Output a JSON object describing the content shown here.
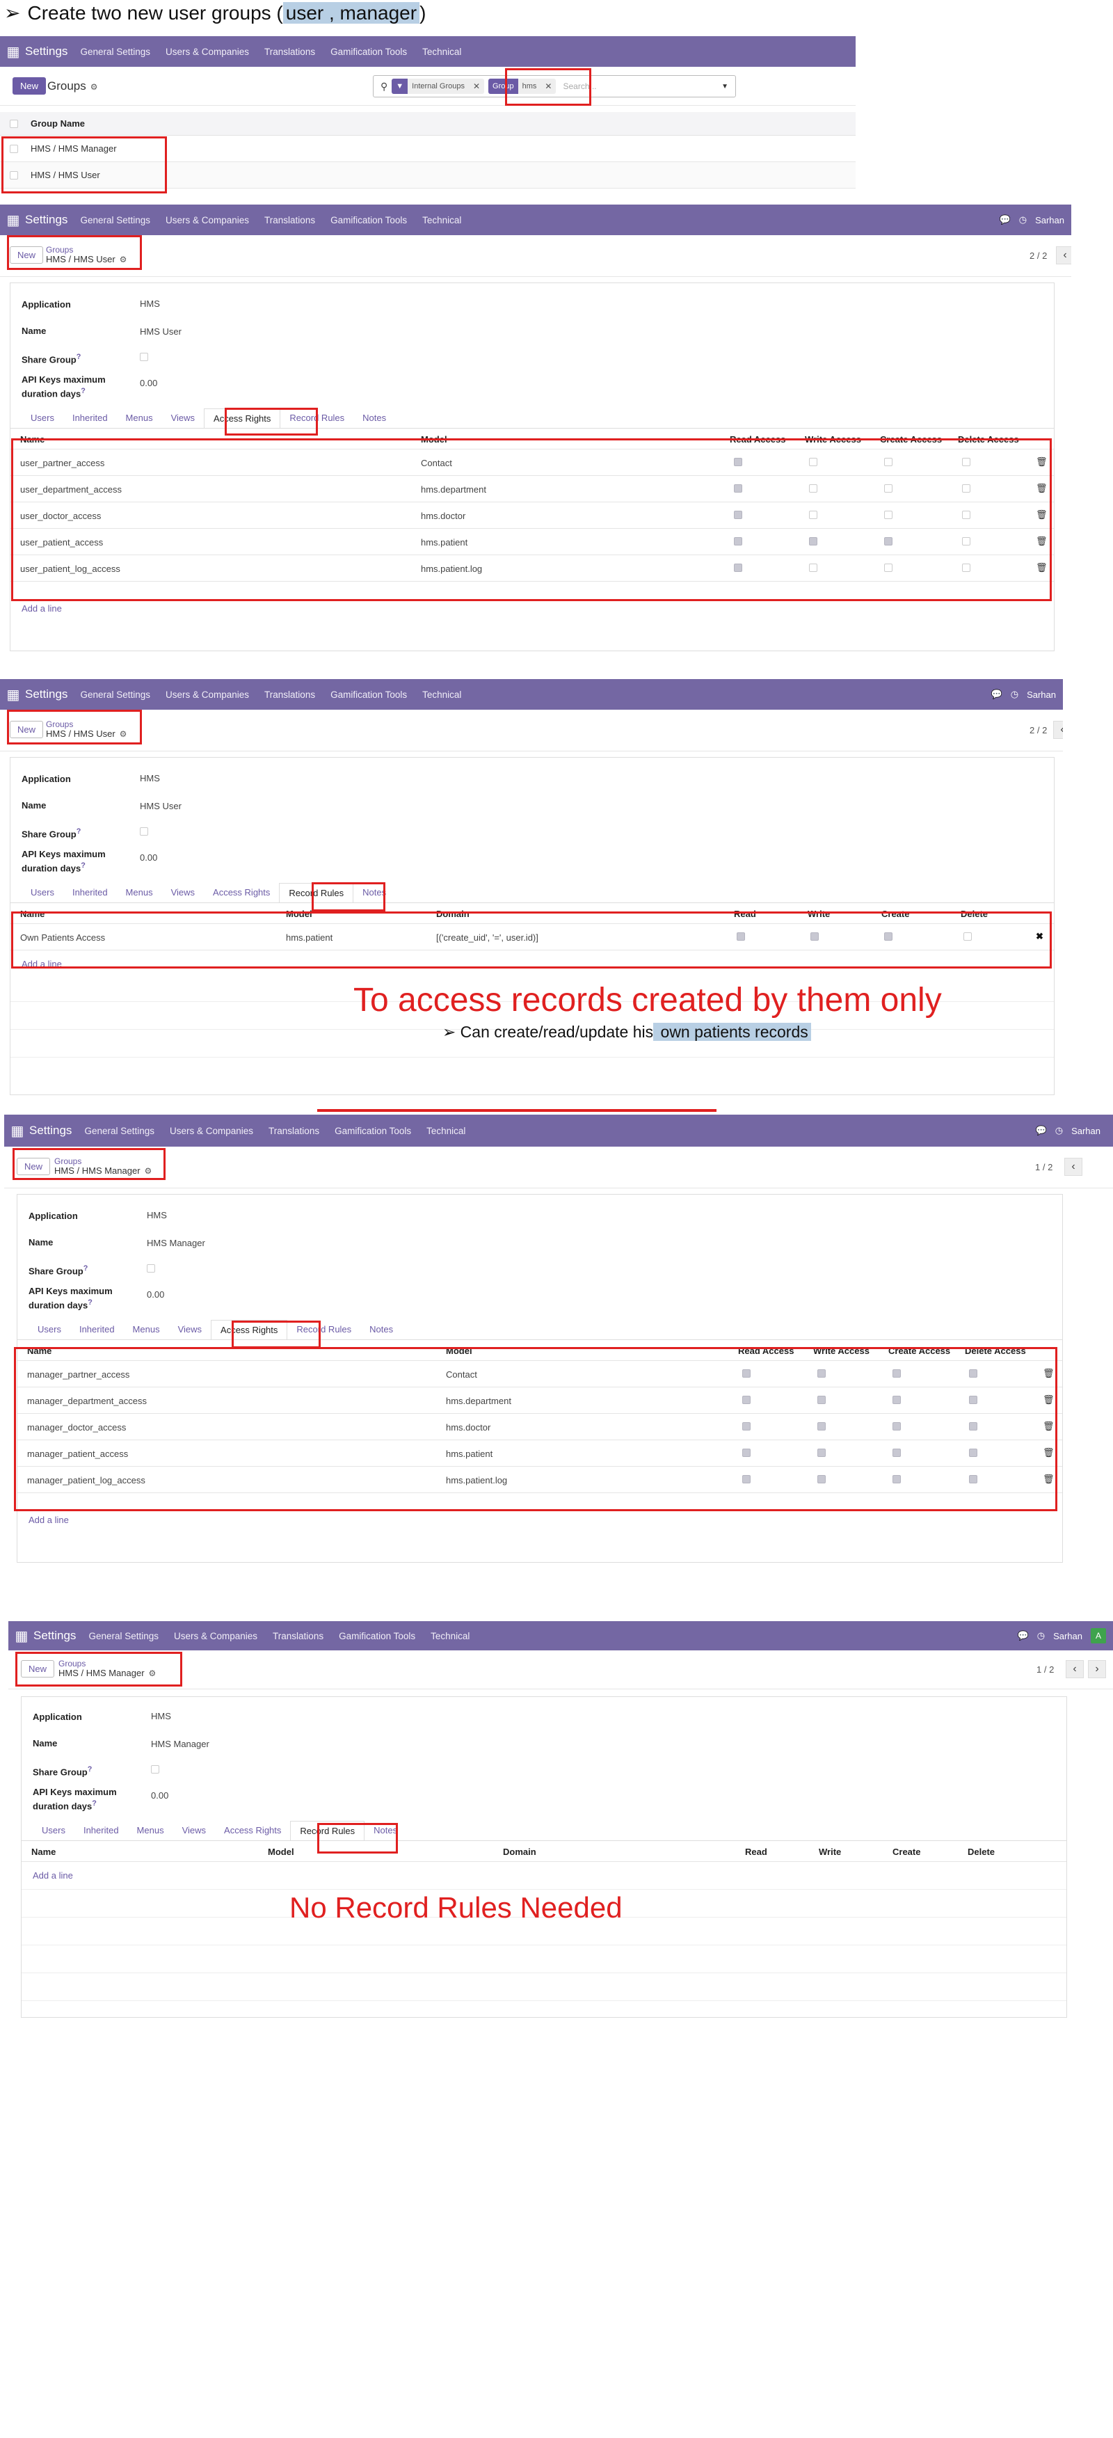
{
  "header": {
    "bullet": "➢",
    "text_before": "Create two new user groups (",
    "highlight": "user , manager",
    "text_after": ")"
  },
  "nav": {
    "app": "Settings",
    "menu": [
      "General Settings",
      "Users & Companies",
      "Translations",
      "Gamification Tools",
      "Technical"
    ],
    "user": "Sarhan",
    "user_short": "Sarhan",
    "avatar_letter": "A"
  },
  "list_view": {
    "new_label": "New",
    "title": "Groups",
    "facets": [
      {
        "label": "Internal Groups"
      },
      {
        "label": "Group",
        "value": "hms"
      }
    ],
    "search_placeholder": "Search...",
    "column": "Group Name",
    "rows": [
      "HMS / HMS Manager",
      "HMS / HMS User"
    ]
  },
  "user_access": {
    "breadcrumb_parent": "Groups",
    "breadcrumb_current": "HMS / HMS User",
    "new_label": "New",
    "pager": "2 / 2",
    "fields": {
      "application_label": "Application",
      "application": "HMS",
      "name_label": "Name",
      "name": "HMS User",
      "share_label": "Share Group",
      "api_label": "API Keys maximum duration days",
      "api": "0.00"
    },
    "tabs": [
      "Users",
      "Inherited",
      "Menus",
      "Views",
      "Access Rights",
      "Record Rules",
      "Notes"
    ],
    "active_tab": "Access Rights",
    "columns": [
      "Name",
      "Model",
      "Read Access",
      "Write Access",
      "Create Access",
      "Delete Access"
    ],
    "rows": [
      {
        "name": "user_partner_access",
        "model": "Contact",
        "read": true,
        "write": false,
        "create": false,
        "delete": false
      },
      {
        "name": "user_department_access",
        "model": "hms.department",
        "read": true,
        "write": false,
        "create": false,
        "delete": false
      },
      {
        "name": "user_doctor_access",
        "model": "hms.doctor",
        "read": true,
        "write": false,
        "create": false,
        "delete": false
      },
      {
        "name": "user_patient_access",
        "model": "hms.patient",
        "read": true,
        "write": true,
        "create": true,
        "delete": false
      },
      {
        "name": "user_patient_log_access",
        "model": "hms.patient.log",
        "read": true,
        "write": false,
        "create": false,
        "delete": false
      }
    ],
    "add_line": "Add a line"
  },
  "user_rules": {
    "breadcrumb_parent": "Groups",
    "breadcrumb_current": "HMS / HMS User",
    "new_label": "New",
    "pager": "2 / 2",
    "fields": {
      "application_label": "Application",
      "application": "HMS",
      "name_label": "Name",
      "name": "HMS User",
      "share_label": "Share Group",
      "api_label": "API Keys maximum duration days",
      "api": "0.00"
    },
    "tabs": [
      "Users",
      "Inherited",
      "Menus",
      "Views",
      "Access Rights",
      "Record Rules",
      "Notes"
    ],
    "active_tab": "Record Rules",
    "columns": [
      "Name",
      "Model",
      "Domain",
      "Read",
      "Write",
      "Create",
      "Delete"
    ],
    "rows": [
      {
        "name": "Own Patients Access",
        "model": "hms.patient",
        "domain": "[('create_uid', '=', user.id)]",
        "read": true,
        "write": true,
        "create": true,
        "delete": false
      }
    ],
    "add_line": "Add a line",
    "annotation": "To access records created by them only",
    "note_bullet": "➢",
    "note_before": "Can create/read/update his",
    "note_highlight": " own patients records"
  },
  "manager_access": {
    "breadcrumb_parent": "Groups",
    "breadcrumb_current": "HMS / HMS Manager",
    "new_label": "New",
    "pager": "1 / 2",
    "fields": {
      "application_label": "Application",
      "application": "HMS",
      "name_label": "Name",
      "name": "HMS Manager",
      "share_label": "Share Group",
      "api_label": "API Keys maximum duration days",
      "api": "0.00"
    },
    "tabs": [
      "Users",
      "Inherited",
      "Menus",
      "Views",
      "Access Rights",
      "Record Rules",
      "Notes"
    ],
    "active_tab": "Access Rights",
    "columns": [
      "Name",
      "Model",
      "Read Access",
      "Write Access",
      "Create Access",
      "Delete Access"
    ],
    "rows": [
      {
        "name": "manager_partner_access",
        "model": "Contact",
        "read": true,
        "write": true,
        "create": true,
        "delete": true
      },
      {
        "name": "manager_department_access",
        "model": "hms.department",
        "read": true,
        "write": true,
        "create": true,
        "delete": true
      },
      {
        "name": "manager_doctor_access",
        "model": "hms.doctor",
        "read": true,
        "write": true,
        "create": true,
        "delete": true
      },
      {
        "name": "manager_patient_access",
        "model": "hms.patient",
        "read": true,
        "write": true,
        "create": true,
        "delete": true
      },
      {
        "name": "manager_patient_log_access",
        "model": "hms.patient.log",
        "read": true,
        "write": true,
        "create": true,
        "delete": true
      }
    ],
    "add_line": "Add a line"
  },
  "manager_rules": {
    "breadcrumb_parent": "Groups",
    "breadcrumb_current": "HMS / HMS Manager",
    "new_label": "New",
    "pager": "1 / 2",
    "fields": {
      "application_label": "Application",
      "application": "HMS",
      "name_label": "Name",
      "name": "HMS Manager",
      "share_label": "Share Group",
      "api_label": "API Keys maximum duration days",
      "api": "0.00"
    },
    "tabs": [
      "Users",
      "Inherited",
      "Menus",
      "Views",
      "Access Rights",
      "Record Rules",
      "Notes"
    ],
    "active_tab": "Record Rules",
    "columns": [
      "Name",
      "Model",
      "Domain",
      "Read",
      "Write",
      "Create",
      "Delete"
    ],
    "add_line": "Add a line",
    "annotation": "No Record Rules Needed"
  }
}
